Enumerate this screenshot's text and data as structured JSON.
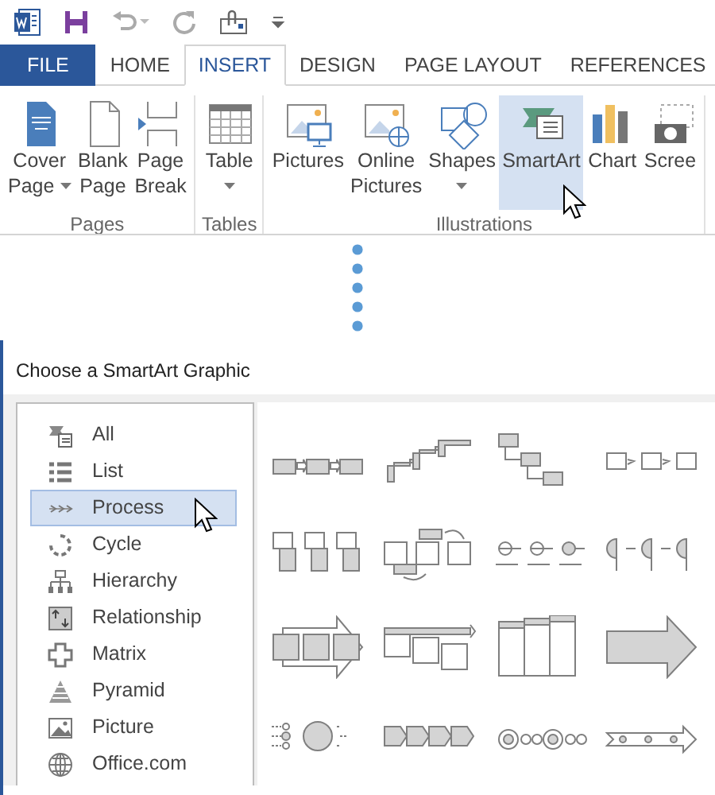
{
  "tabs": [
    {
      "label": "FILE",
      "kind": "file",
      "selected": false
    },
    {
      "label": "HOME",
      "kind": "tab",
      "selected": false
    },
    {
      "label": "INSERT",
      "kind": "tab",
      "selected": true
    },
    {
      "label": "DESIGN",
      "kind": "tab",
      "selected": false
    },
    {
      "label": "PAGE LAYOUT",
      "kind": "tab",
      "selected": false
    },
    {
      "label": "REFERENCES",
      "kind": "tab",
      "selected": false
    }
  ],
  "ribbon_groups": [
    {
      "label": "Pages",
      "buttons": [
        {
          "lines": [
            "Cover",
            "Page"
          ],
          "kind": "cover-page",
          "dropdown": true,
          "selected": false
        },
        {
          "lines": [
            "Blank",
            "Page"
          ],
          "kind": "blank-page",
          "dropdown": false,
          "selected": false
        },
        {
          "lines": [
            "Page",
            "Break"
          ],
          "kind": "page-break",
          "dropdown": false,
          "selected": false
        }
      ]
    },
    {
      "label": "Tables",
      "buttons": [
        {
          "lines": [
            "Table"
          ],
          "kind": "table",
          "dropdown": true,
          "selected": false
        }
      ]
    },
    {
      "label": "Illustrations",
      "buttons": [
        {
          "lines": [
            "Pictures"
          ],
          "kind": "pictures",
          "dropdown": false,
          "selected": false
        },
        {
          "lines": [
            "Online",
            "Pictures"
          ],
          "kind": "online-pictures",
          "dropdown": false,
          "selected": false
        },
        {
          "lines": [
            "Shapes"
          ],
          "kind": "shapes",
          "dropdown": true,
          "selected": false
        },
        {
          "lines": [
            "SmartArt"
          ],
          "kind": "smartart",
          "dropdown": false,
          "selected": true
        },
        {
          "lines": [
            "Chart"
          ],
          "kind": "chart",
          "dropdown": false,
          "selected": false
        },
        {
          "lines": [
            "Scree"
          ],
          "kind": "screenshot",
          "dropdown": false,
          "selected": false
        }
      ]
    }
  ],
  "dialog": {
    "title": "Choose a SmartArt Graphic",
    "categories": [
      {
        "label": "All",
        "kind": "all",
        "selected": false
      },
      {
        "label": "List",
        "kind": "list",
        "selected": false
      },
      {
        "label": "Process",
        "kind": "process",
        "selected": true
      },
      {
        "label": "Cycle",
        "kind": "cycle",
        "selected": false
      },
      {
        "label": "Hierarchy",
        "kind": "hierarchy",
        "selected": false
      },
      {
        "label": "Relationship",
        "kind": "relationship",
        "selected": false
      },
      {
        "label": "Matrix",
        "kind": "matrix",
        "selected": false
      },
      {
        "label": "Pyramid",
        "kind": "pyramid",
        "selected": false
      },
      {
        "label": "Picture",
        "kind": "picture",
        "selected": false
      },
      {
        "label": "Office.com",
        "kind": "office",
        "selected": false
      }
    ]
  }
}
